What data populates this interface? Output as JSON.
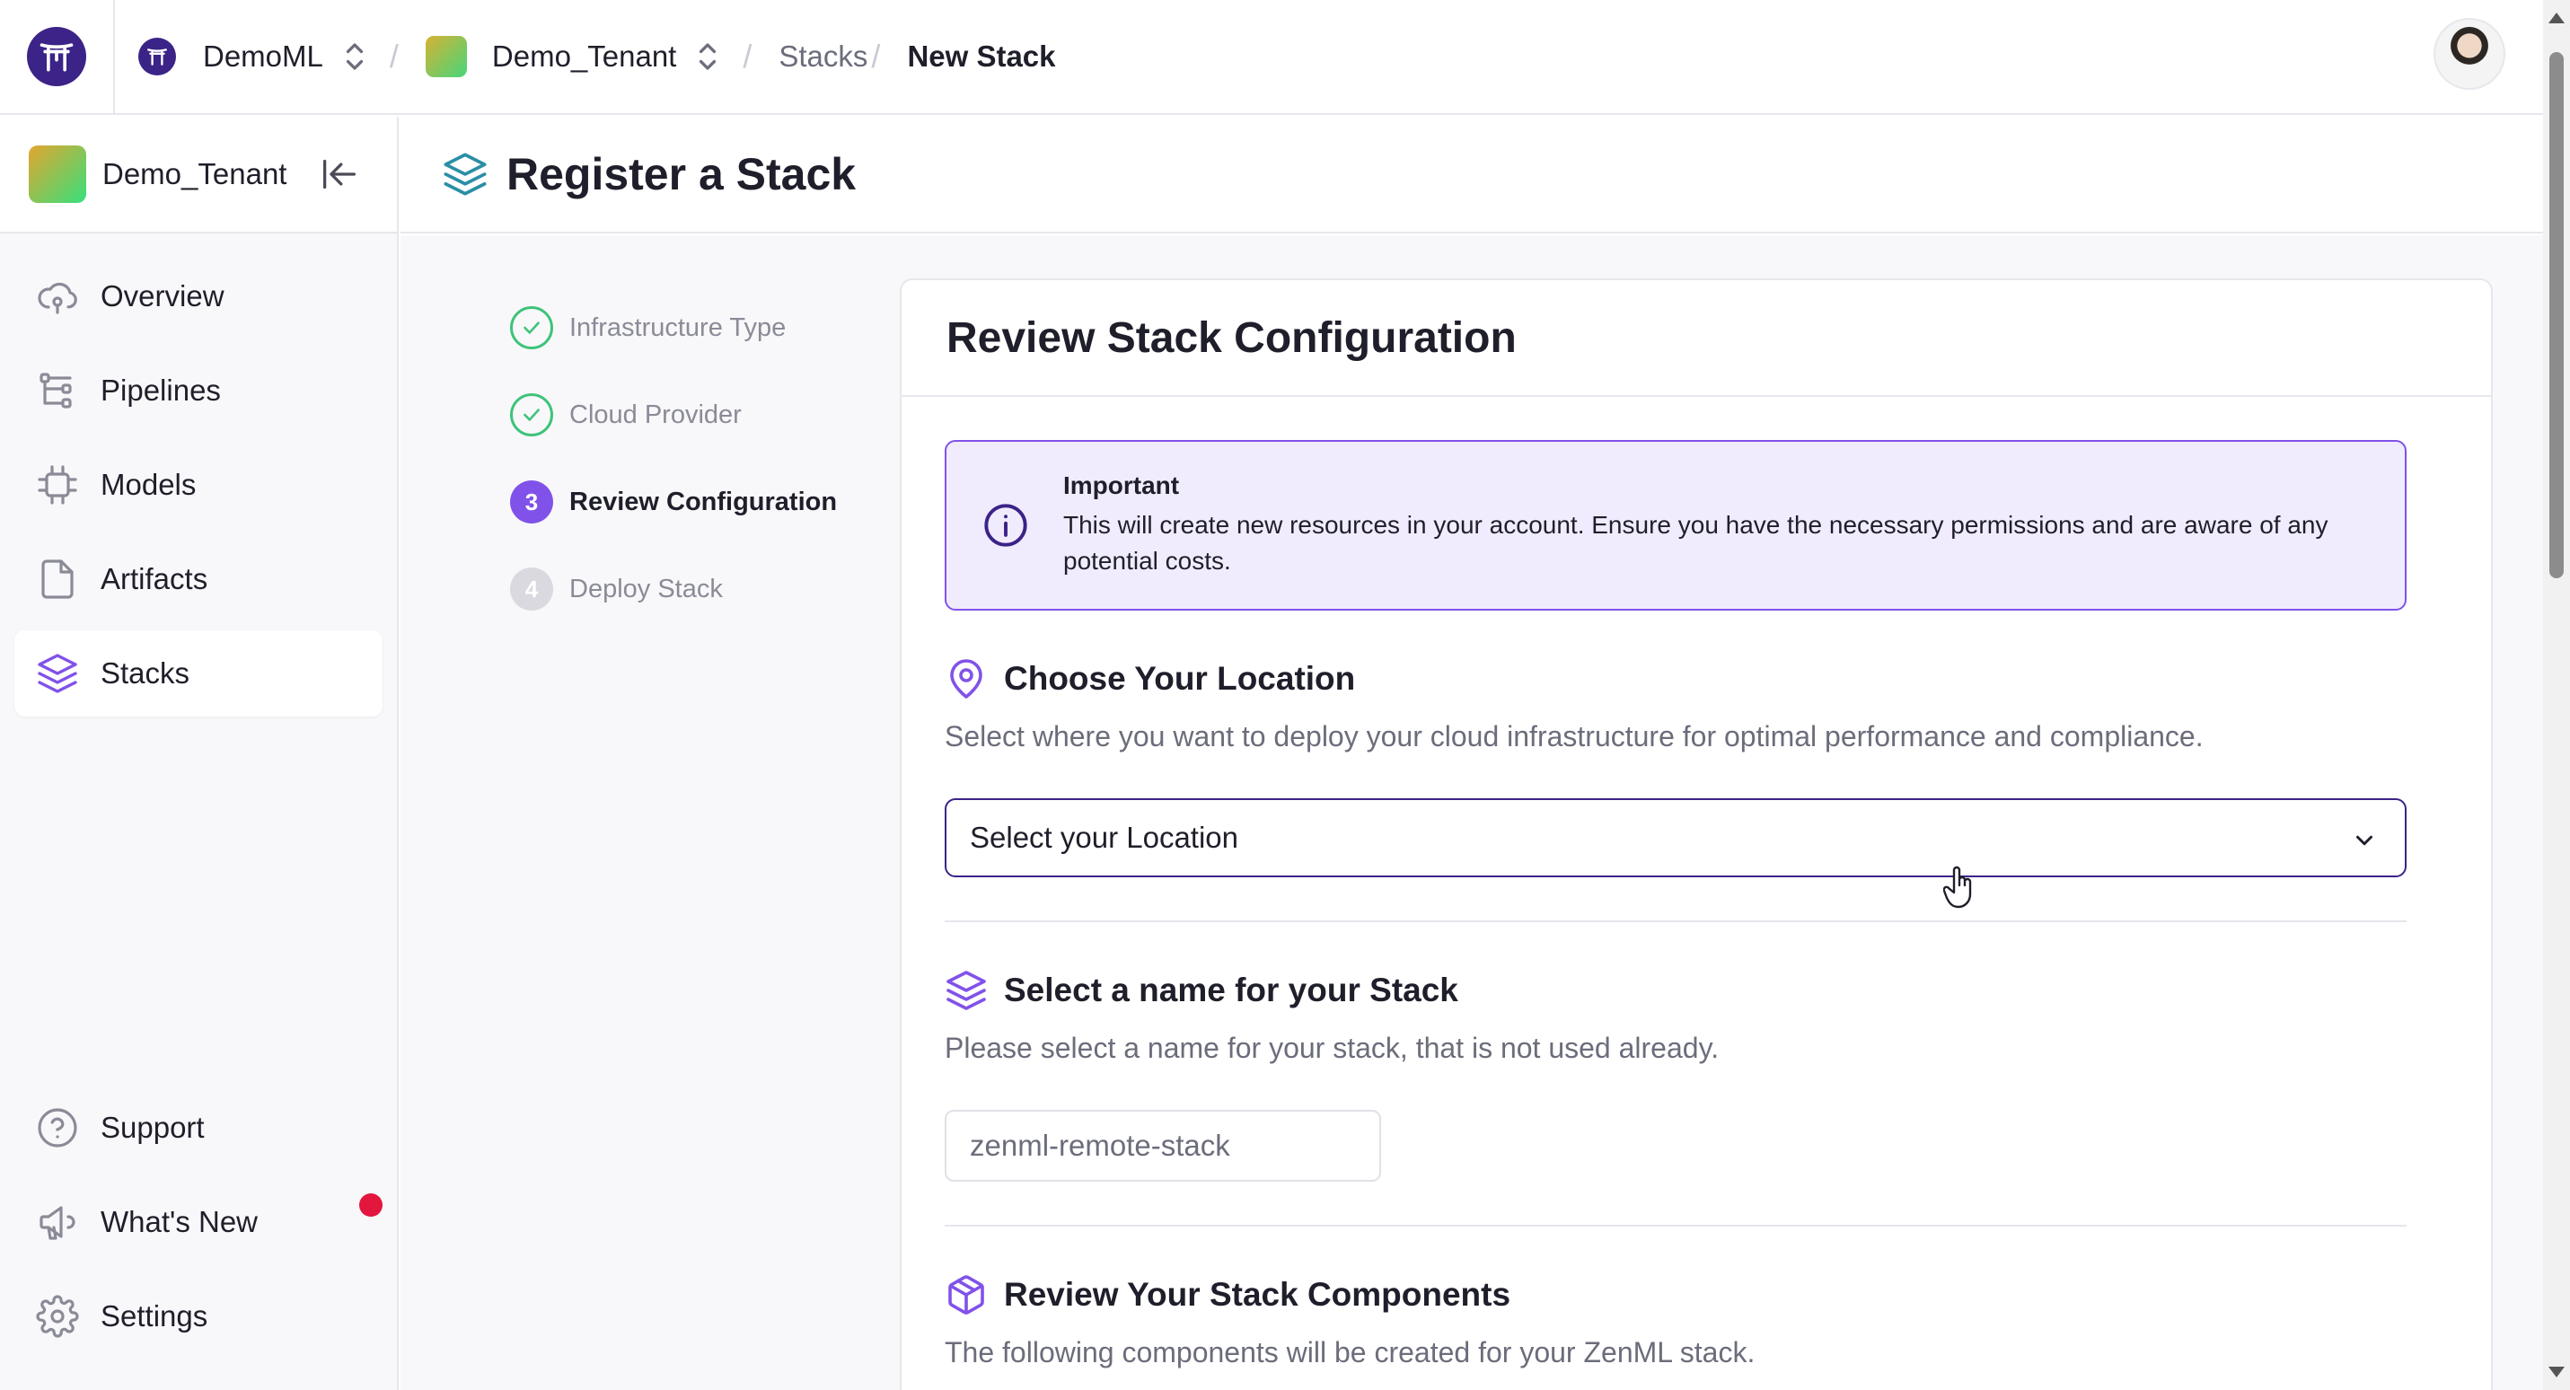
{
  "topbar": {
    "org_name": "DemoML",
    "tenant_name": "Demo_Tenant",
    "crumb_stacks": "Stacks",
    "crumb_current": "New Stack"
  },
  "sidebar": {
    "tenant_name": "Demo_Tenant",
    "items": [
      {
        "label": "Overview",
        "icon": "overview-icon"
      },
      {
        "label": "Pipelines",
        "icon": "pipelines-icon"
      },
      {
        "label": "Models",
        "icon": "models-icon"
      },
      {
        "label": "Artifacts",
        "icon": "artifacts-icon"
      },
      {
        "label": "Stacks",
        "icon": "stacks-icon",
        "active": true
      }
    ],
    "bottom_items": [
      {
        "label": "Support",
        "icon": "help-icon"
      },
      {
        "label": "What's New",
        "icon": "megaphone-icon",
        "has_notification": true
      },
      {
        "label": "Settings",
        "icon": "gear-icon"
      }
    ]
  },
  "page": {
    "title": "Register a Stack"
  },
  "steps": [
    {
      "number": "1",
      "label": "Infrastructure Type",
      "status": "done"
    },
    {
      "number": "2",
      "label": "Cloud Provider",
      "status": "done"
    },
    {
      "number": "3",
      "label": "Review Configuration",
      "status": "current"
    },
    {
      "number": "4",
      "label": "Deploy Stack",
      "status": "pending"
    }
  ],
  "card": {
    "title": "Review Stack Configuration",
    "notice": {
      "title": "Important",
      "text": "This will create new resources in your account. Ensure you have the necessary permissions and are aware of any potential costs."
    },
    "location": {
      "title": "Choose Your Location",
      "description": "Select where you want to deploy your cloud infrastructure for optimal performance and compliance.",
      "select_value": "Select your Location"
    },
    "stack_name": {
      "title": "Select a name for your Stack",
      "description": "Please select a name for your stack, that is not used already.",
      "input_value": "zenml-remote-stack"
    },
    "components": {
      "title": "Review Your Stack Components",
      "description": "The following components will be created for your ZenML stack."
    }
  },
  "colors": {
    "accent": "#8152e9",
    "brand": "#3b2387",
    "success": "#3fc37a",
    "notification": "#e3163e",
    "notice_bg": "#f1ecfd"
  }
}
